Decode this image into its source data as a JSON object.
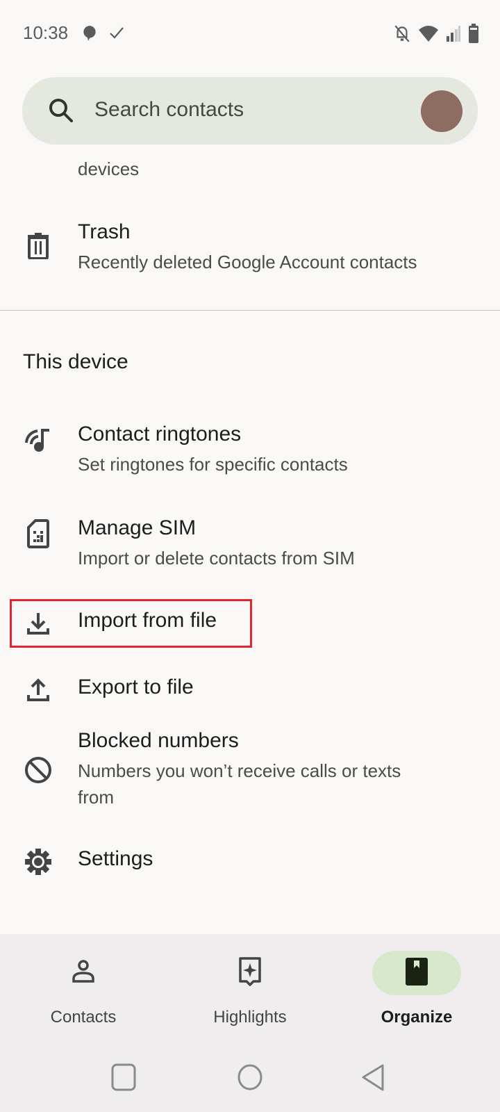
{
  "status_bar": {
    "time": "10:38",
    "left_icons": [
      "chat-bubble-icon",
      "check-icon"
    ],
    "right_icons": [
      "notifications-off-icon",
      "wifi-icon",
      "cell-signal-icon",
      "battery-icon"
    ]
  },
  "search": {
    "placeholder": "Search contacts",
    "avatar_color": "#8d6c61"
  },
  "partial_item": {
    "subtitle_tail": "devices"
  },
  "google_items": [
    {
      "icon": "trash-icon",
      "title": "Trash",
      "subtitle": "Recently deleted Google Account contacts"
    }
  ],
  "device_section": {
    "header": "This device",
    "items": [
      {
        "icon": "ringtone-icon",
        "title": "Contact ringtones",
        "subtitle": "Set ringtones for specific contacts"
      },
      {
        "icon": "sim-card-icon",
        "title": "Manage SIM",
        "subtitle": "Import or delete contacts from SIM"
      },
      {
        "icon": "download-icon",
        "title": "Import from file",
        "subtitle": "",
        "highlighted": true
      },
      {
        "icon": "upload-icon",
        "title": "Export to file",
        "subtitle": ""
      },
      {
        "icon": "block-icon",
        "title": "Blocked numbers",
        "subtitle": "Numbers you won’t receive calls or texts from"
      },
      {
        "icon": "gear-icon",
        "title": "Settings",
        "subtitle": ""
      }
    ]
  },
  "bottom_nav": {
    "tabs": [
      {
        "icon": "person-icon",
        "label": "Contacts",
        "active": false
      },
      {
        "icon": "highlights-icon",
        "label": "Highlights",
        "active": false
      },
      {
        "icon": "organize-icon",
        "label": "Organize",
        "active": true
      }
    ],
    "active_color": "#d7e8cd"
  },
  "system_nav": [
    "recents-button",
    "home-button",
    "back-button"
  ],
  "colors": {
    "highlight_box": "#e0262e",
    "search_bg": "#e4e8df"
  }
}
